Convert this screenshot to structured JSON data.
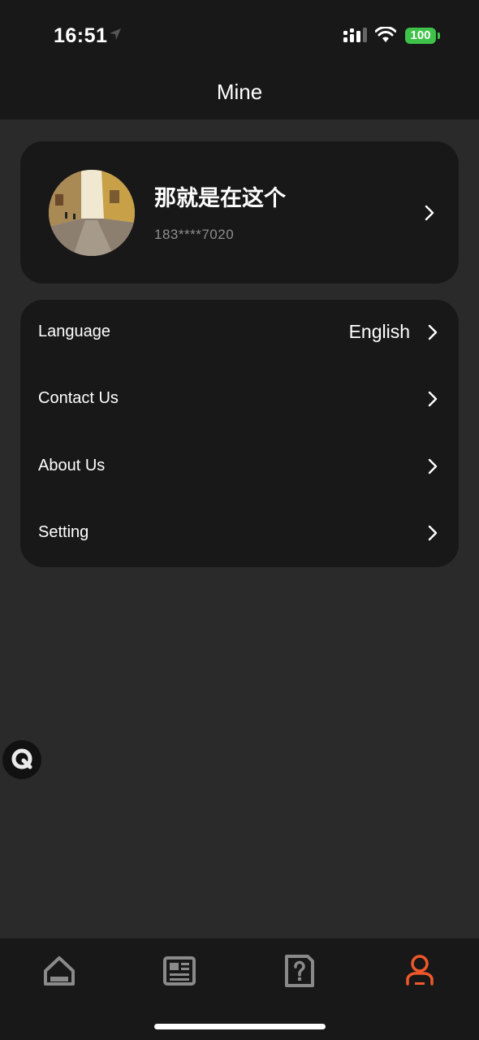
{
  "status_bar": {
    "time": "16:51",
    "battery": "100",
    "icons": [
      "location-arrow-icon",
      "signal-icon",
      "wifi-icon",
      "battery-icon"
    ]
  },
  "header": {
    "title": "Mine"
  },
  "profile": {
    "username": "那就是在这个",
    "phone": "183****7020"
  },
  "menu": {
    "items": [
      {
        "label": "Language",
        "value": "English"
      },
      {
        "label": "Contact Us"
      },
      {
        "label": "About Us"
      },
      {
        "label": "Setting"
      }
    ]
  },
  "tab_bar": {
    "tabs": [
      {
        "icon": "home-icon",
        "active": false
      },
      {
        "icon": "news-icon",
        "active": false
      },
      {
        "icon": "question-doc-icon",
        "active": false
      },
      {
        "icon": "profile-icon",
        "active": true
      }
    ]
  },
  "colors": {
    "background": "#2a2a2a",
    "surface": "#181818",
    "accent": "#f0582a",
    "inactive_icon": "#8a8a8a",
    "battery": "#3ec24a"
  }
}
